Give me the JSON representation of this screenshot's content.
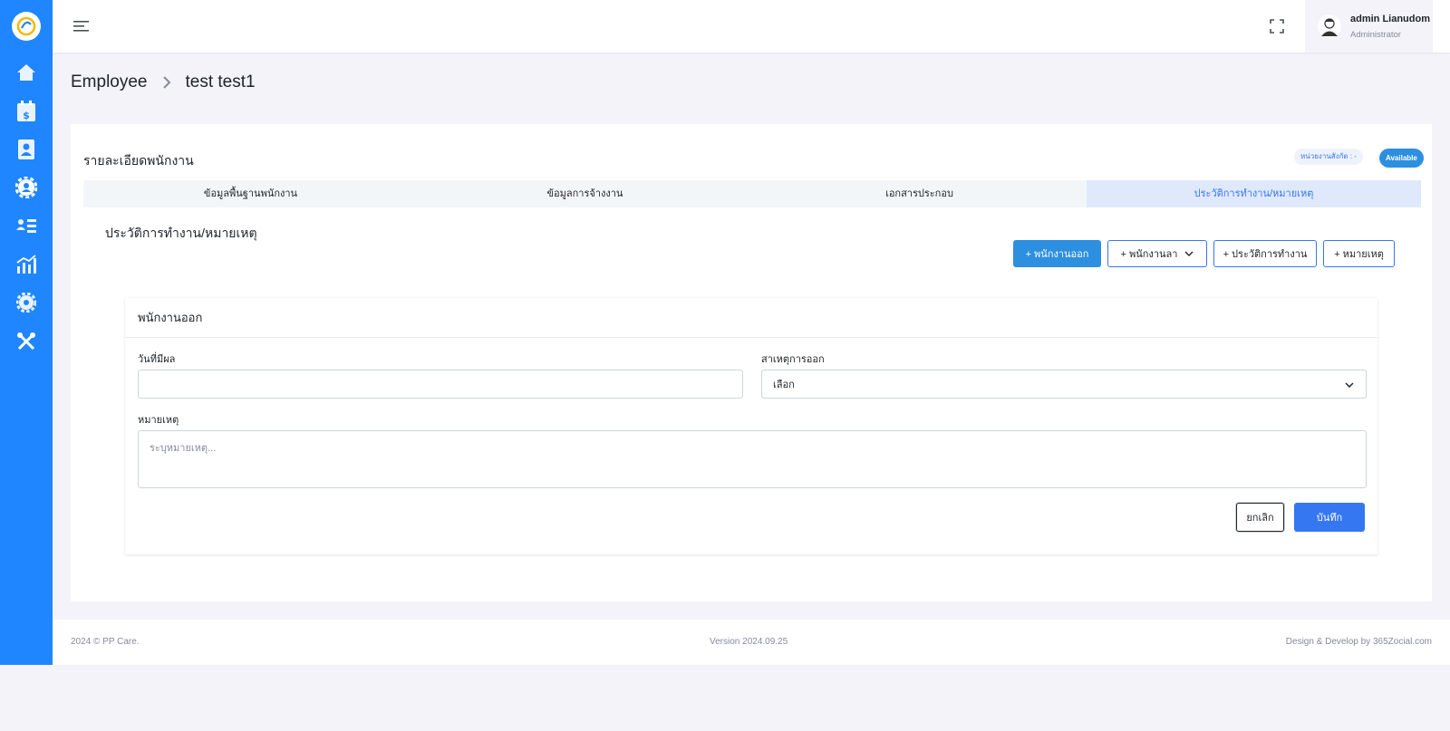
{
  "sidebar": {
    "items": [
      {
        "icon": "home-icon"
      },
      {
        "icon": "payroll-calendar-icon"
      },
      {
        "icon": "contacts-book-icon"
      },
      {
        "icon": "team-gear-icon"
      },
      {
        "icon": "user-list-icon"
      },
      {
        "icon": "chart-icon"
      },
      {
        "icon": "gear-icon"
      },
      {
        "icon": "tools-icon"
      }
    ]
  },
  "header": {
    "user_name": "admin Lianudom",
    "user_role": "Administrator"
  },
  "breadcrumb": {
    "parent": "Employee",
    "current": "test test1"
  },
  "card": {
    "title": "รายละเอียดพนักงาน",
    "unit_badge": "หน่วยงานสังกัด : -",
    "status_badge": "Available",
    "tabs": [
      {
        "label": "ข้อมูลพื้นฐานพนักงาน"
      },
      {
        "label": "ข้อมูลการจ้างงาน"
      },
      {
        "label": "เอกสารประกอบ"
      },
      {
        "label": "ประวัติการทำงาน/หมายเหตุ"
      }
    ],
    "section_title": "ประวัติการทำงาน/หมายเหตุ",
    "actions": {
      "resign": "+ พนักงานออก",
      "leave": "+ พนักงานลา",
      "work_history": "+ ประวัติการทำงาน",
      "remark": "+ หมายเหตุ"
    }
  },
  "form": {
    "title": "พนักงานออก",
    "effective_date_label": "วันที่มีผล",
    "effective_date_value": "",
    "reason_label": "สาเหตุการออก",
    "reason_value": "เลือก",
    "remark_label": "หมายเหตุ",
    "remark_placeholder": "ระบุหมายเหตุ...",
    "cancel": "ยกเลิก",
    "save": "บันทึก"
  },
  "footer": {
    "copyright": "2024 © PP Care.",
    "version": "Version 2024.09.25",
    "credit": "Design & Develop by 365Zocial.com"
  },
  "colors": {
    "sidebar": "#1f86ff",
    "primary": "#3577f1",
    "button_blue": "#2d8fe0"
  }
}
